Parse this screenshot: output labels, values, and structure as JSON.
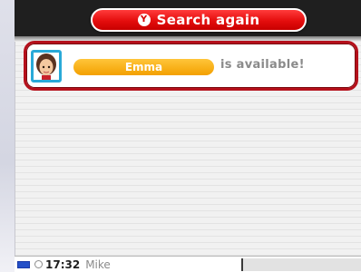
{
  "search_button": {
    "label": "Search again",
    "icon": "y-button-icon",
    "icon_glyph": "Y"
  },
  "result": {
    "name": "Emma",
    "status_text": "is available!",
    "avatar_icon": "mii-avatar-icon"
  },
  "status_bar": {
    "battery_icon": "battery-icon",
    "clock_icon": "clock-icon",
    "time": "17:32",
    "user": "Mike"
  },
  "colors": {
    "accent_red": "#e40d0d",
    "card_border": "#b5101b",
    "name_pill": "#f3a000",
    "avatar_border": "#29a9d8"
  }
}
